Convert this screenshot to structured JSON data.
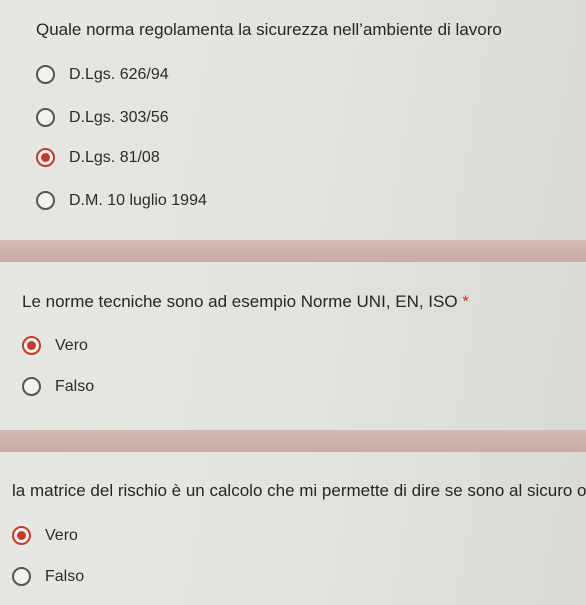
{
  "questions": [
    {
      "text": "Quale norma regolamenta la sicurezza nell’ambiente di lavoro",
      "required_mark": "",
      "options": [
        {
          "label": "D.Lgs. 626/94",
          "selected": false
        },
        {
          "label": "D.Lgs. 303/56",
          "selected": false
        },
        {
          "label": "D.Lgs. 81/08",
          "selected": true
        },
        {
          "label": "D.M. 10 luglio 1994",
          "selected": false
        }
      ]
    },
    {
      "text": "Le norme tecniche sono ad esempio Norme UNI, EN, ISO",
      "required_mark": "*",
      "options": [
        {
          "label": "Vero",
          "selected": true
        },
        {
          "label": "Falso",
          "selected": false
        }
      ]
    },
    {
      "text": "la matrice del rischio è un calcolo che mi permette di dire se sono al sicuro o",
      "required_mark": "",
      "options": [
        {
          "label": "Vero",
          "selected": true
        },
        {
          "label": "Falso",
          "selected": false
        }
      ]
    }
  ],
  "colors": {
    "accent": "#c33b2f",
    "card": "#e4e4df",
    "divider": "#ceb1ae"
  }
}
